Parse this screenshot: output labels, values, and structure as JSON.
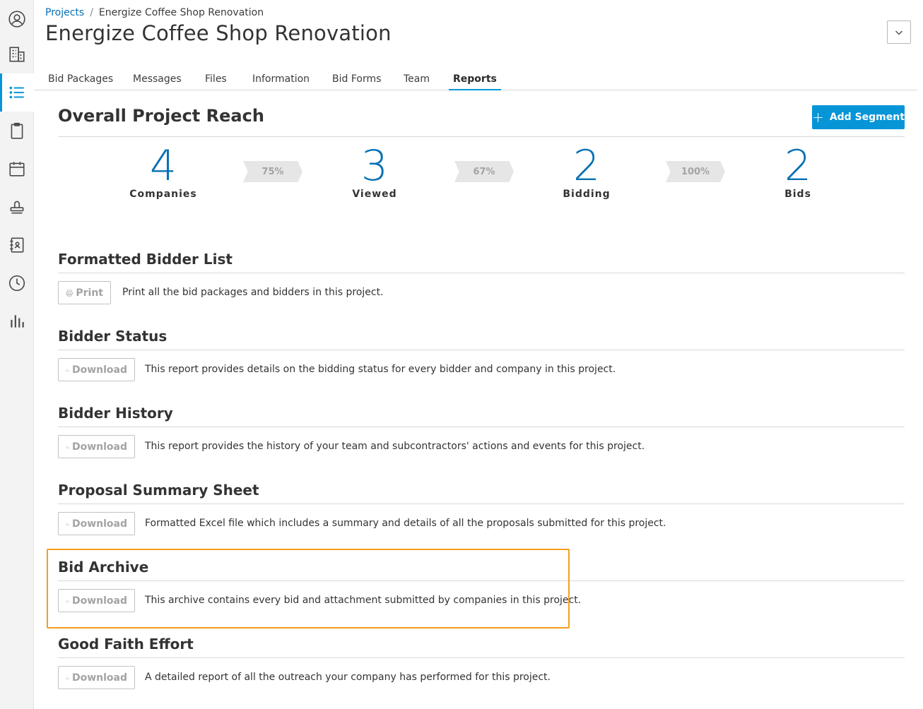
{
  "sidebar": {
    "items": [
      {
        "name": "profile",
        "icon": "user-circle-icon"
      },
      {
        "name": "companies",
        "icon": "building-icon"
      },
      {
        "name": "projects",
        "icon": "list-icon",
        "active": true
      },
      {
        "name": "clipboard",
        "icon": "clipboard-icon"
      },
      {
        "name": "calendar",
        "icon": "calendar-icon"
      },
      {
        "name": "stamp",
        "icon": "stamp-icon"
      },
      {
        "name": "directory",
        "icon": "address-book-icon"
      },
      {
        "name": "history",
        "icon": "clock-icon"
      },
      {
        "name": "analytics",
        "icon": "bar-chart-icon"
      }
    ]
  },
  "header": {
    "breadcrumb_root": "Projects",
    "breadcrumb_separator": "/",
    "breadcrumb_current": "Energize Coffee Shop Renovation",
    "title": "Energize Coffee Shop Renovation"
  },
  "tabs": [
    {
      "label": "Bid Packages"
    },
    {
      "label": "Messages"
    },
    {
      "label": "Files"
    },
    {
      "label": "Information"
    },
    {
      "label": "Bid Forms"
    },
    {
      "label": "Team"
    },
    {
      "label": "Reports",
      "active": true
    }
  ],
  "reach": {
    "title": "Overall Project Reach",
    "add_segment_label": "Add Segment",
    "stats": [
      {
        "value": "4",
        "label": "Companies"
      },
      {
        "value": "3",
        "label": "Viewed"
      },
      {
        "value": "2",
        "label": "Bidding"
      },
      {
        "value": "2",
        "label": "Bids"
      }
    ],
    "conversions": [
      "75%",
      "67%",
      "100%"
    ]
  },
  "reports": [
    {
      "title": "Formatted Bidder List",
      "button": "Print",
      "icon": "printer-icon",
      "description": "Print all the bid packages and bidders in this project."
    },
    {
      "title": "Bidder Status",
      "button": "Download",
      "icon": "download-icon",
      "description": "This report provides details on the bidding status for every bidder and company in this project."
    },
    {
      "title": "Bidder History",
      "button": "Download",
      "icon": "download-icon",
      "description": "This report provides the history of your team and subcontractors' actions and events for this project."
    },
    {
      "title": "Proposal Summary Sheet",
      "button": "Download",
      "icon": "download-icon",
      "description": "Formatted Excel file which includes a summary and details of all the proposals submitted for this project."
    },
    {
      "title": "Bid Archive",
      "button": "Download",
      "icon": "download-icon",
      "description": "This archive contains every bid and attachment submitted by companies in this project.",
      "highlighted": true
    },
    {
      "title": "Good Faith Effort",
      "button": "Download",
      "icon": "download-icon",
      "description": "A detailed report of all the outreach your company has performed for this project."
    }
  ],
  "colors": {
    "accent": "#0696d7",
    "link": "#0670b4",
    "highlight": "#f59e1c"
  }
}
